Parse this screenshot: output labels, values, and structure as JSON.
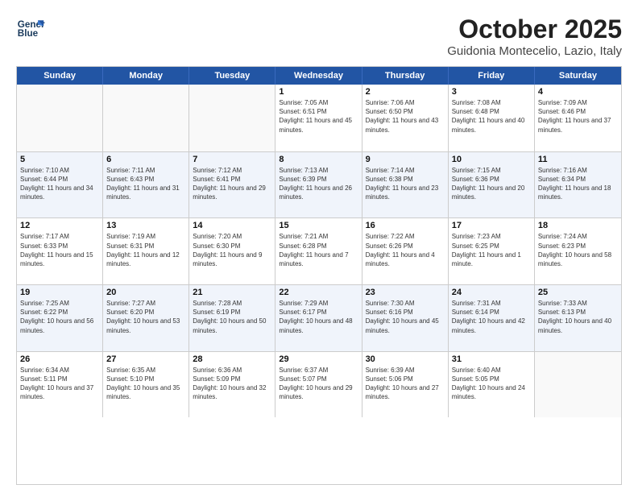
{
  "logo": {
    "line1": "General",
    "line2": "Blue"
  },
  "title": "October 2025",
  "subtitle": "Guidonia Montecelio, Lazio, Italy",
  "days_of_week": [
    "Sunday",
    "Monday",
    "Tuesday",
    "Wednesday",
    "Thursday",
    "Friday",
    "Saturday"
  ],
  "weeks": [
    [
      {
        "day": "",
        "info": ""
      },
      {
        "day": "",
        "info": ""
      },
      {
        "day": "",
        "info": ""
      },
      {
        "day": "1",
        "info": "Sunrise: 7:05 AM\nSunset: 6:51 PM\nDaylight: 11 hours and 45 minutes."
      },
      {
        "day": "2",
        "info": "Sunrise: 7:06 AM\nSunset: 6:50 PM\nDaylight: 11 hours and 43 minutes."
      },
      {
        "day": "3",
        "info": "Sunrise: 7:08 AM\nSunset: 6:48 PM\nDaylight: 11 hours and 40 minutes."
      },
      {
        "day": "4",
        "info": "Sunrise: 7:09 AM\nSunset: 6:46 PM\nDaylight: 11 hours and 37 minutes."
      }
    ],
    [
      {
        "day": "5",
        "info": "Sunrise: 7:10 AM\nSunset: 6:44 PM\nDaylight: 11 hours and 34 minutes."
      },
      {
        "day": "6",
        "info": "Sunrise: 7:11 AM\nSunset: 6:43 PM\nDaylight: 11 hours and 31 minutes."
      },
      {
        "day": "7",
        "info": "Sunrise: 7:12 AM\nSunset: 6:41 PM\nDaylight: 11 hours and 29 minutes."
      },
      {
        "day": "8",
        "info": "Sunrise: 7:13 AM\nSunset: 6:39 PM\nDaylight: 11 hours and 26 minutes."
      },
      {
        "day": "9",
        "info": "Sunrise: 7:14 AM\nSunset: 6:38 PM\nDaylight: 11 hours and 23 minutes."
      },
      {
        "day": "10",
        "info": "Sunrise: 7:15 AM\nSunset: 6:36 PM\nDaylight: 11 hours and 20 minutes."
      },
      {
        "day": "11",
        "info": "Sunrise: 7:16 AM\nSunset: 6:34 PM\nDaylight: 11 hours and 18 minutes."
      }
    ],
    [
      {
        "day": "12",
        "info": "Sunrise: 7:17 AM\nSunset: 6:33 PM\nDaylight: 11 hours and 15 minutes."
      },
      {
        "day": "13",
        "info": "Sunrise: 7:19 AM\nSunset: 6:31 PM\nDaylight: 11 hours and 12 minutes."
      },
      {
        "day": "14",
        "info": "Sunrise: 7:20 AM\nSunset: 6:30 PM\nDaylight: 11 hours and 9 minutes."
      },
      {
        "day": "15",
        "info": "Sunrise: 7:21 AM\nSunset: 6:28 PM\nDaylight: 11 hours and 7 minutes."
      },
      {
        "day": "16",
        "info": "Sunrise: 7:22 AM\nSunset: 6:26 PM\nDaylight: 11 hours and 4 minutes."
      },
      {
        "day": "17",
        "info": "Sunrise: 7:23 AM\nSunset: 6:25 PM\nDaylight: 11 hours and 1 minute."
      },
      {
        "day": "18",
        "info": "Sunrise: 7:24 AM\nSunset: 6:23 PM\nDaylight: 10 hours and 58 minutes."
      }
    ],
    [
      {
        "day": "19",
        "info": "Sunrise: 7:25 AM\nSunset: 6:22 PM\nDaylight: 10 hours and 56 minutes."
      },
      {
        "day": "20",
        "info": "Sunrise: 7:27 AM\nSunset: 6:20 PM\nDaylight: 10 hours and 53 minutes."
      },
      {
        "day": "21",
        "info": "Sunrise: 7:28 AM\nSunset: 6:19 PM\nDaylight: 10 hours and 50 minutes."
      },
      {
        "day": "22",
        "info": "Sunrise: 7:29 AM\nSunset: 6:17 PM\nDaylight: 10 hours and 48 minutes."
      },
      {
        "day": "23",
        "info": "Sunrise: 7:30 AM\nSunset: 6:16 PM\nDaylight: 10 hours and 45 minutes."
      },
      {
        "day": "24",
        "info": "Sunrise: 7:31 AM\nSunset: 6:14 PM\nDaylight: 10 hours and 42 minutes."
      },
      {
        "day": "25",
        "info": "Sunrise: 7:33 AM\nSunset: 6:13 PM\nDaylight: 10 hours and 40 minutes."
      }
    ],
    [
      {
        "day": "26",
        "info": "Sunrise: 6:34 AM\nSunset: 5:11 PM\nDaylight: 10 hours and 37 minutes."
      },
      {
        "day": "27",
        "info": "Sunrise: 6:35 AM\nSunset: 5:10 PM\nDaylight: 10 hours and 35 minutes."
      },
      {
        "day": "28",
        "info": "Sunrise: 6:36 AM\nSunset: 5:09 PM\nDaylight: 10 hours and 32 minutes."
      },
      {
        "day": "29",
        "info": "Sunrise: 6:37 AM\nSunset: 5:07 PM\nDaylight: 10 hours and 29 minutes."
      },
      {
        "day": "30",
        "info": "Sunrise: 6:39 AM\nSunset: 5:06 PM\nDaylight: 10 hours and 27 minutes."
      },
      {
        "day": "31",
        "info": "Sunrise: 6:40 AM\nSunset: 5:05 PM\nDaylight: 10 hours and 24 minutes."
      },
      {
        "day": "",
        "info": ""
      }
    ]
  ],
  "shaded_rows": [
    1,
    3
  ]
}
